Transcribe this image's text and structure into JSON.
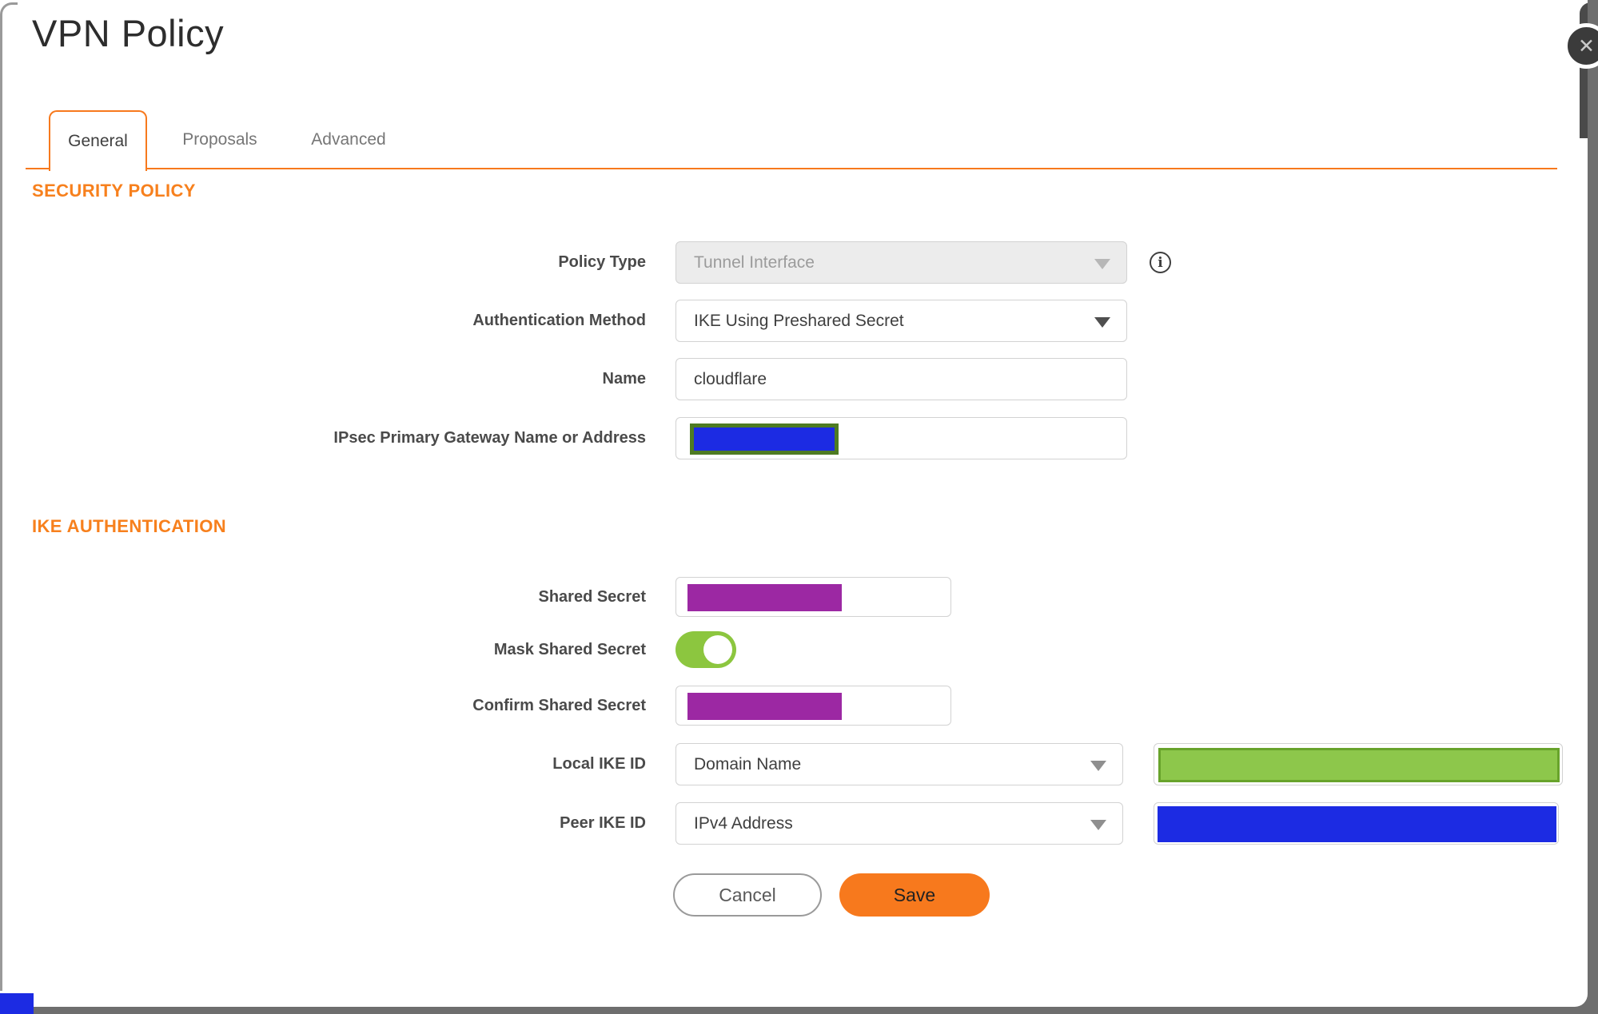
{
  "title": "VPN Policy",
  "icons": {
    "close": "✕",
    "info": "i"
  },
  "tabs": {
    "general": "General",
    "proposals": "Proposals",
    "advanced": "Advanced",
    "active": "General"
  },
  "sections": {
    "security_policy": "SECURITY POLICY",
    "ike_authentication": "IKE AUTHENTICATION"
  },
  "fields": {
    "policy_type": {
      "label": "Policy Type",
      "value": "Tunnel Interface",
      "disabled": true
    },
    "auth_method": {
      "label": "Authentication Method",
      "value": "IKE Using Preshared Secret"
    },
    "name": {
      "label": "Name",
      "value": "cloudflare"
    },
    "gateway": {
      "label": "IPsec Primary Gateway Name or Address",
      "value": "",
      "redaction": "blue-olive-border"
    },
    "shared_secret": {
      "label": "Shared Secret",
      "redaction": "purple"
    },
    "mask_shared_secret": {
      "label": "Mask Shared Secret",
      "state": "on"
    },
    "confirm_shared_secret": {
      "label": "Confirm Shared Secret",
      "redaction": "purple"
    },
    "local_ike_id": {
      "label": "Local IKE ID",
      "value": "Domain Name",
      "redaction": "green"
    },
    "peer_ike_id": {
      "label": "Peer IKE ID",
      "value": "IPv4 Address",
      "redaction": "blue"
    }
  },
  "actions": {
    "cancel": "Cancel",
    "save": "Save"
  },
  "colors": {
    "accent_orange": "#F7791D",
    "toggle_green": "#8CC63F",
    "redact_purple": "#9C28A3",
    "redact_blue": "#1C2BE3",
    "redact_green": "#8DC74B",
    "surround_gray": "#6e6e6e"
  }
}
